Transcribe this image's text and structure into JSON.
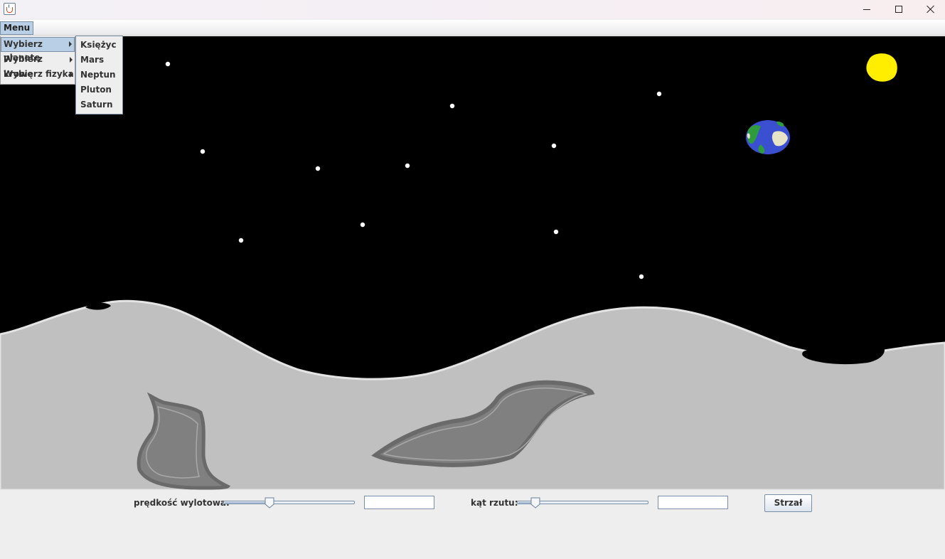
{
  "window": {
    "title": "",
    "icon": "java-cup-icon",
    "controls": [
      "minimize-icon",
      "maximize-icon",
      "close-icon"
    ]
  },
  "menubar": {
    "menu_label": "Menu",
    "items": [
      {
        "label": "Wybierz planetę",
        "active": true
      },
      {
        "label": "Wybierz krowę",
        "active": false
      },
      {
        "label": "Wybierz fizyka",
        "active": false
      }
    ],
    "planet_submenu": [
      "Księżyc",
      "Mars",
      "Neptun",
      "Pluton",
      "Saturn"
    ]
  },
  "scene": {
    "sky_color": "#000000",
    "ground_color": "#c0c0c0",
    "crater_color": "#808080",
    "sun_color": "#ffee00",
    "planet_icon": "earth-icon",
    "sun_icon": "sun-icon"
  },
  "controls": {
    "speed_label": "prędkość wylotowa:",
    "speed_value": "",
    "speed_slider_fraction": 0.34,
    "angle_label": "kąt rzutu:",
    "angle_value": "",
    "angle_slider_fraction": 0.11,
    "shoot_label": "Strzał"
  }
}
